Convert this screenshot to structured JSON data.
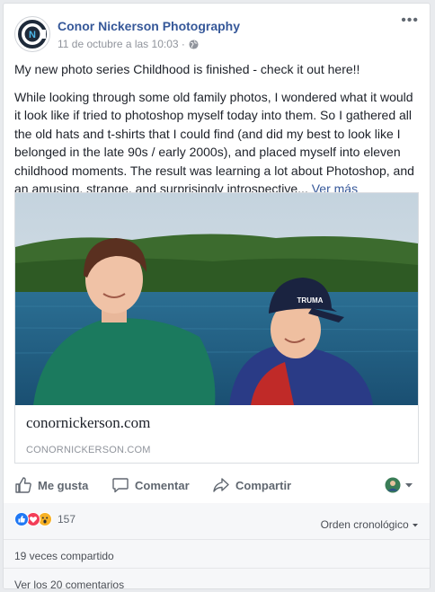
{
  "post": {
    "page_name": "Conor Nickerson Photography",
    "timestamp": "11 de octubre a las 10:03 ·",
    "visibility_icon": "globe-icon",
    "paragraph1": "My new photo series Childhood is finished - check it out here!!",
    "paragraph2": "While looking through some old family photos, I wondered what it would it look like if tried to photoshop myself today into them. So I gathered all the old hats and t-shirts that I could find (and did my best to look like I belonged in the late 90s / early 2000s), and placed myself into eleven childhood moments. The result was learning a lot about Photoshop, and an amusing, strange, and surprisingly introspective...",
    "see_more": "Ver más"
  },
  "link": {
    "title": "conornickerson.com",
    "domain": "CONORNICKERSON.COM",
    "cap_text": "TRUMA"
  },
  "actions": {
    "like": "Me gusta",
    "comment": "Comentar",
    "share": "Compartir"
  },
  "reactions": {
    "count": "157",
    "types": [
      "like",
      "love",
      "wow"
    ],
    "sort_label": "Orden cronológico"
  },
  "stats": {
    "shares": "19 veces compartido",
    "comments": "Ver los 20 comentarios"
  },
  "colors": {
    "link_blue": "#365899",
    "like_blue": "#2078f4",
    "love_red": "#f33e58",
    "wow_yellow": "#f7b125"
  }
}
